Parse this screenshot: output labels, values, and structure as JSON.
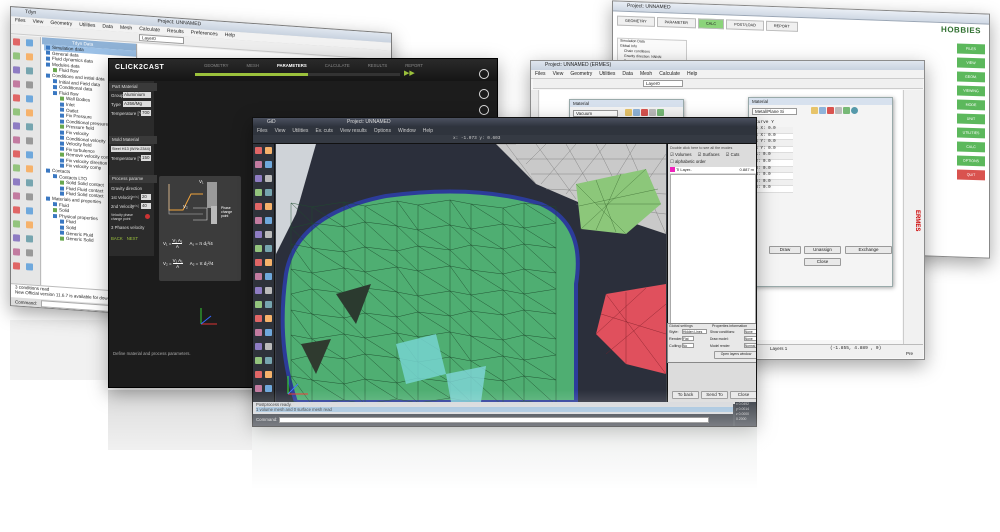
{
  "tdyn": {
    "title": "Tdyn",
    "project_title": "Project: UNNAMED",
    "menu": [
      "Files",
      "View",
      "Geometry",
      "Utilities",
      "Data",
      "Mesh",
      "Calculate",
      "Results",
      "Preferences",
      "Help"
    ],
    "layer_select": "Layer0",
    "tree_header": "Tdyn Data",
    "tree": [
      "Simulation data",
      "General data",
      "Fluid dynamics data",
      "Modules data",
      "Fluid flow",
      "Conditions and initial data",
      "Initial and Field data",
      "Conditional data",
      "Fluid flow",
      "Wall Bodies",
      "Inlet",
      "Outlet",
      "Fix Pressure",
      "Conditional pressure",
      "Pressure field",
      "Fix velocity",
      "Conditional velocity",
      "Velocity field",
      "Fix turbulence",
      "Remove velocity constraints",
      "Fix velocity direction",
      "Fix velocity comp",
      "Contacts",
      "Contacts LTO",
      "Solid Solid contact",
      "Fluid Fluid contact",
      "Fluid Solid contact",
      "Materials and properties",
      "Fluid",
      "Solid",
      "Physical properties",
      "Fluid",
      "Solid",
      "Generic Fluid",
      "Generic Solid"
    ],
    "status_lines": [
      "3 conditions read",
      "New Official version 11.6.7 is available for downlo"
    ],
    "command_label": "Command:"
  },
  "clickcast": {
    "logo": "CLICK2CAST",
    "tabs": [
      "GEOMETRY",
      "MESH",
      "PARAMETERS",
      "CALCULATE",
      "RESULTS",
      "REPORT"
    ],
    "active_tab": "PARAMETERS",
    "part_material": {
      "header": "Part Material",
      "group_label": "Group",
      "group_value": "Aluminium",
      "type_label": "Type",
      "type_value": "A356/Mg",
      "temp_label": "Temperature [°C]",
      "temp_value": "700"
    },
    "mold_material": {
      "header": "Mold Material",
      "type_value": "Steel H13 (W.Nr.2344)",
      "temp_label": "Temperature [°C]",
      "temp_value": "150"
    },
    "process": {
      "header": "Process parame",
      "gravity_label": "Gravity direction",
      "v1_label": "1st Velocity",
      "v1_unit": "[m/s]",
      "v1_value": "20",
      "v2_label": "2nd Velocity",
      "v2_unit": "[m/s]",
      "v2_value": "40",
      "velocity_phase_label": "Velocity phase change point",
      "three_phase_label": "3 Phases velocity",
      "back_btn": "BACK",
      "next_btn": "NEXT"
    },
    "diagram": {
      "v1": "V₁",
      "v2": "V₂",
      "phase_label": "Phase change point",
      "eq1": "V₁ =",
      "frac1_num": "V₁ A₁",
      "frac_den": "A",
      "eq1_rhs": "A₁ = π d₁²/4",
      "eq2": "V₂ =",
      "frac2_num": "V₁ A₁",
      "eq2_rhs": "A₂ = π d₂²/4"
    },
    "status": "Define material and process parameters."
  },
  "gid": {
    "title": "GiD",
    "project_title": "Project: UNNAMED",
    "menu": [
      "Files",
      "View",
      "Utilities",
      "Ev. cuts",
      "View results",
      "Options",
      "Window",
      "Help"
    ],
    "coords": "x: -1.073  y: 0.603",
    "vis_panel": {
      "hint": "Double click here to see all the modes",
      "volumes": "Volumes",
      "surfaces": "Surfaces",
      "cuts": "Cuts",
      "alphabetic_order": "alphabetic order",
      "layer_name": "Ti Layer..",
      "layer_value": "0.887 m"
    },
    "global_settings": {
      "title": "Global settings",
      "style_label": "Style:",
      "style_value": "Hidden Lines",
      "render_label": "Render:",
      "render_value": "Flat",
      "culling_label": "Culling:",
      "culling_value": "No",
      "props_title": "Properties information",
      "show_conditions": "Show conditions:",
      "draw_model": "Draw model:",
      "model_render": "Model render:",
      "none": "None",
      "normal": "Normal",
      "open_layers": "Open layers window"
    },
    "tab_buttons": [
      "Remove",
      "Delete"
    ],
    "bottom_buttons": [
      "To back",
      "Send To",
      "Close"
    ],
    "status_lines": [
      "Postprocess ready.",
      "1 volume mesh and 0 surface mesh read"
    ],
    "command_label": "Command:",
    "corner": [
      "x 0.0492",
      "y 0.0014",
      "z 0.0000",
      "0.2000"
    ]
  },
  "ermes": {
    "title": "Project: UNNAMED (ERMES)",
    "menu": [
      "Files",
      "View",
      "Geometry",
      "Utilities",
      "Data",
      "Mesh",
      "Calculate",
      "Help"
    ],
    "layer": "Layer0",
    "material_dialog": "Material",
    "material_value": "Vacuum",
    "dialog2_title": "Material",
    "dialog2_value": "Metal/Plane Si",
    "list_header": "Curve  Y",
    "list_values": [
      "Ls X: 0.0",
      "Ls X: 0.0",
      "Ls Y: 0.0",
      "Ls Y: 0.0",
      "h1: 0.0",
      "h2: 0.0",
      "h3: 0.0",
      "h4: 0.0",
      "h5: 0.0",
      "h6: 0.0"
    ],
    "buttons": [
      "Draw",
      "Unassign",
      "Exchange",
      "Close"
    ],
    "layers_label": "Layers 1",
    "coords": "(-1.855,  4.889 , 0)",
    "pre": "Pre",
    "side_text": "ERMES"
  },
  "hobbies": {
    "title": "Project: UNNAMED",
    "logo": "HOBBIES",
    "tabs": [
      "GEOMETRY",
      "PARAMETER",
      "CALC",
      "POST/LOAD",
      "REPORT"
    ],
    "tree_items": [
      "Simulation Data",
      "Global Info",
      "Chain conditions",
      "Gravity direction: NNNN",
      "Force at 0: NNNN",
      "Coordinate test",
      "Beginning of Load Layer"
    ],
    "right_buttons": [
      "FILES",
      "VIEW",
      "GEOM.",
      "VIEWING",
      "MODE",
      "UNIT",
      "UTILITIES",
      "CALC",
      "OPTIONS",
      "QUIT"
    ],
    "right_button_colors": [
      "#5cb85c",
      "#5cb85c",
      "#5cb85c",
      "#5cb85c",
      "#5cb85c",
      "#5cb85c",
      "#5cb85c",
      "#5cb85c",
      "#5cb85c",
      "#d9534f"
    ]
  }
}
